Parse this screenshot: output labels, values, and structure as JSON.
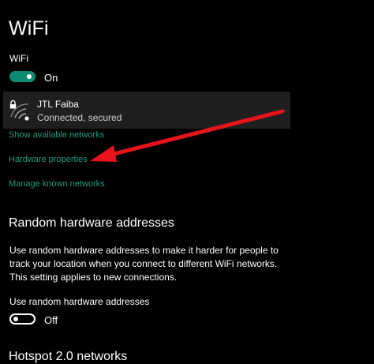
{
  "page": {
    "title": "WiFi"
  },
  "wifi": {
    "label": "WiFi",
    "toggle_state": "On",
    "toggle_on": true
  },
  "network": {
    "name": "JTL Faiba",
    "status": "Connected, secured"
  },
  "links": {
    "show_available": "Show available networks",
    "hardware_properties": "Hardware properties",
    "manage_known": "Manage known networks"
  },
  "random_hw": {
    "heading": "Random hardware addresses",
    "description": "Use random hardware addresses to make it harder for people to track your location when you connect to different WiFi networks. This setting applies to new connections.",
    "toggle_label": "Use random hardware addresses",
    "toggle_state": "Off",
    "toggle_on": false
  },
  "hotspot": {
    "heading": "Hotspot 2.0 networks"
  },
  "colors": {
    "accent": "#0d8a70",
    "link": "#1b9b80",
    "annotation_arrow": "#e8141c",
    "card_bg": "#1f1f1f"
  },
  "icons": {
    "lock": "lock-icon",
    "wifi_signal": "wifi-signal-icon"
  }
}
